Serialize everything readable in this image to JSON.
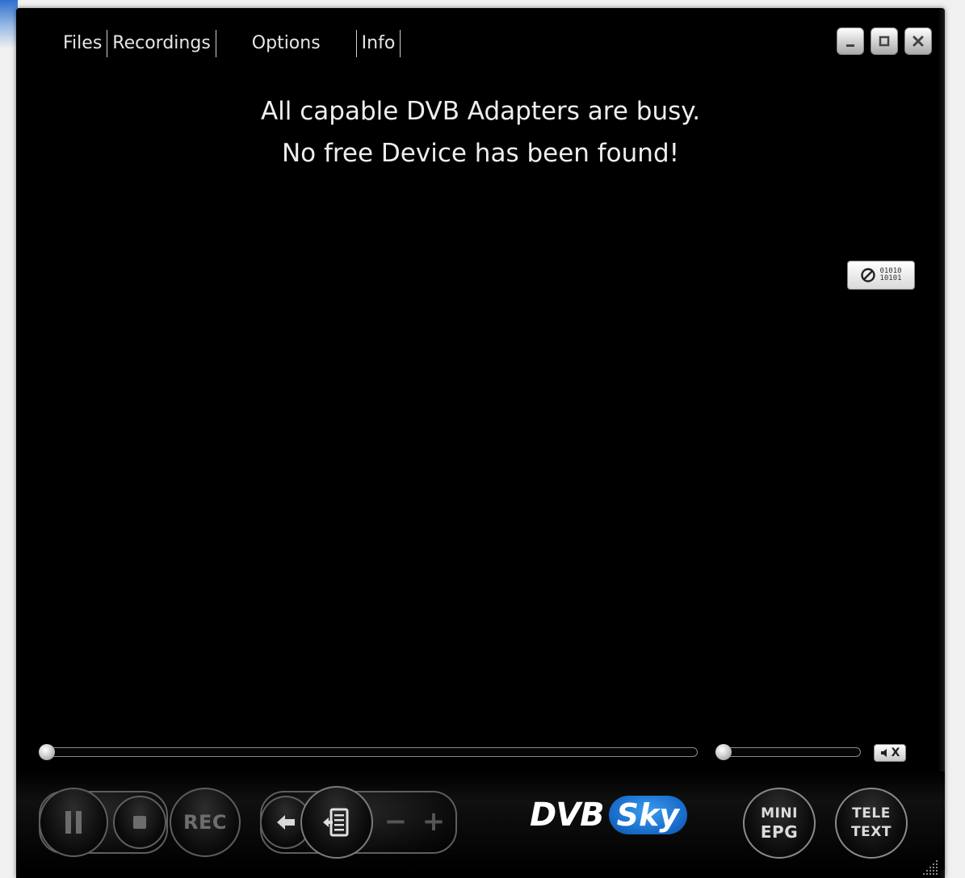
{
  "menu": {
    "files": "Files",
    "recordings": "Recordings",
    "options": "Options",
    "info": "Info"
  },
  "window_buttons": {
    "minimize_icon": "minimize-icon",
    "maximize_icon": "maximize-icon",
    "close_icon": "close-icon"
  },
  "message": {
    "line1": "All capable DVB Adapters are busy.",
    "line2": "No free Device has been found!"
  },
  "binary_badge": {
    "icon": "no-signal-icon",
    "row1": "01010",
    "row2": "10101"
  },
  "playback": {
    "seek_position": 0,
    "volume_level": 0,
    "mute_label": "X",
    "mute_icon": "speaker-icon"
  },
  "controls": {
    "pause_icon": "pause-icon",
    "stop_icon": "stop-icon",
    "rec_label": "REC",
    "back_icon": "back-arrow-icon",
    "playlist_icon": "playlist-icon",
    "minus_label": "−",
    "plus_label": "+",
    "mini_epg_line1": "MINI",
    "mini_epg_line2": "EPG",
    "teletext_line1": "TELE",
    "teletext_line2": "TEXT"
  },
  "brand": {
    "dvb": "DVB",
    "sky": "Sky"
  },
  "colors": {
    "window_bg": "#000000",
    "brand_blue": "#1769c7",
    "text_light": "#eeeeee",
    "control_gray": "#777777"
  }
}
